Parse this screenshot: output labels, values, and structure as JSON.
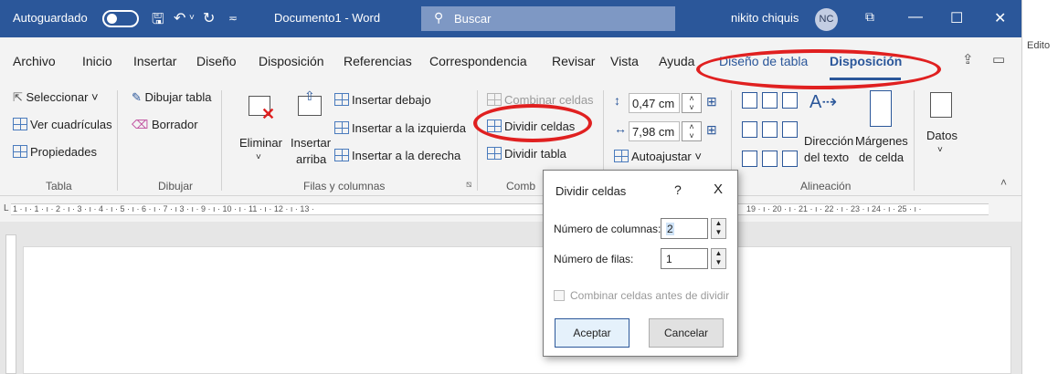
{
  "titlebar": {
    "autosave": "Autoguardado",
    "doc_title": "Documento1  -  Word",
    "search_placeholder": "Buscar",
    "user": "nikito chiquis",
    "initials": "NC"
  },
  "side_panel_label": "Edito",
  "tabs": [
    "Archivo",
    "Inicio",
    "Insertar",
    "Diseño",
    "Disposición",
    "Referencias",
    "Correspondencia",
    "Revisar",
    "Vista",
    "Ayuda",
    "Diseño de tabla",
    "Disposición"
  ],
  "ribbon": {
    "tabla": {
      "select": "Seleccionar ˅",
      "grid": "Ver cuadrículas",
      "props": "Propiedades",
      "group": "Tabla"
    },
    "dibujar": {
      "draw": "Dibujar tabla",
      "eraser": "Borrador",
      "group": "Dibujar"
    },
    "filas": {
      "delete": "Eliminar",
      "insert_above_1": "Insertar",
      "insert_above_2": "arriba",
      "insert_below": "Insertar debajo",
      "insert_left": "Insertar a la izquierda",
      "insert_right": "Insertar a la derecha",
      "group": "Filas y columnas"
    },
    "combinar": {
      "merge": "Combinar celdas",
      "split_cells": "Dividir celdas",
      "split_table": "Dividir tabla",
      "group": "Comb"
    },
    "tamano": {
      "height": "0,47 cm",
      "width": "7,98 cm",
      "autofit": "Autoajustar ˅"
    },
    "alineacion": {
      "direction_1": "Dirección",
      "direction_2": "del texto",
      "margins_1": "Márgenes",
      "margins_2": "de celda",
      "group": "Alineación"
    },
    "datos": {
      "label": "Datos"
    }
  },
  "ruler_text": "1 · ı · 1 · ı · 2 · ı · 3 · ı · 4 · ı · 5 · ı · 6 · ı · 7 · ı  3 · ı · 9 · ı · 10 · ı · 11 · ı · 12 · ı · 13 ·",
  "ruler_text_right": "19 · ı · 20 · ı · 21 · ı · 22 · ı · 23 · ı   24 · ı · 25 · ı ·",
  "dialog": {
    "title": "Dividir celdas",
    "help": "?",
    "close": "X",
    "columns_label": "Número de columnas:",
    "columns_value": "2",
    "rows_label": "Número de filas:",
    "rows_value": "1",
    "merge_before": "Combinar celdas antes de dividir",
    "ok": "Aceptar",
    "cancel": "Cancelar"
  },
  "colors": {
    "titlebar": "#2b579a",
    "accent": "#2b579a",
    "annotation": "#e02020"
  }
}
